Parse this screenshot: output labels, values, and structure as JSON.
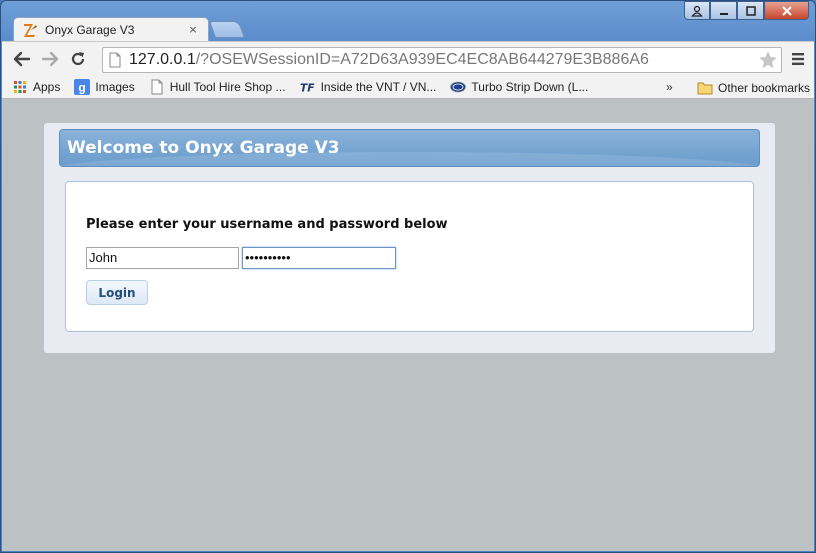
{
  "browser": {
    "tab_title": "Onyx Garage V3",
    "tab_close": "×",
    "url_host": "127.0.0.1",
    "url_rest": "/?OSEWSessionID=A72D63A939EC4EC8AB644279E3B886A6",
    "bookmarks": [
      {
        "label": "Apps",
        "icon": "apps-grid-icon"
      },
      {
        "label": "Images",
        "icon": "google-icon"
      },
      {
        "label": "Hull Tool Hire Shop ...",
        "icon": "page-icon"
      },
      {
        "label": "Inside the VNT / VN...",
        "icon": "tf-icon"
      },
      {
        "label": "Turbo Strip Down (L...",
        "icon": "ford-icon"
      }
    ],
    "bookmarks_overflow": "»",
    "other_bookmarks": "Other bookmarks"
  },
  "page": {
    "header_title": "Welcome to Onyx Garage V3",
    "prompt": "Please enter your username and password below",
    "username_value": "John",
    "password_value": "••••••••••",
    "login_label": "Login"
  },
  "colors": {
    "header_blue": "#77a5d2",
    "page_bg": "#bcc1c3",
    "login_text": "#25507d"
  }
}
